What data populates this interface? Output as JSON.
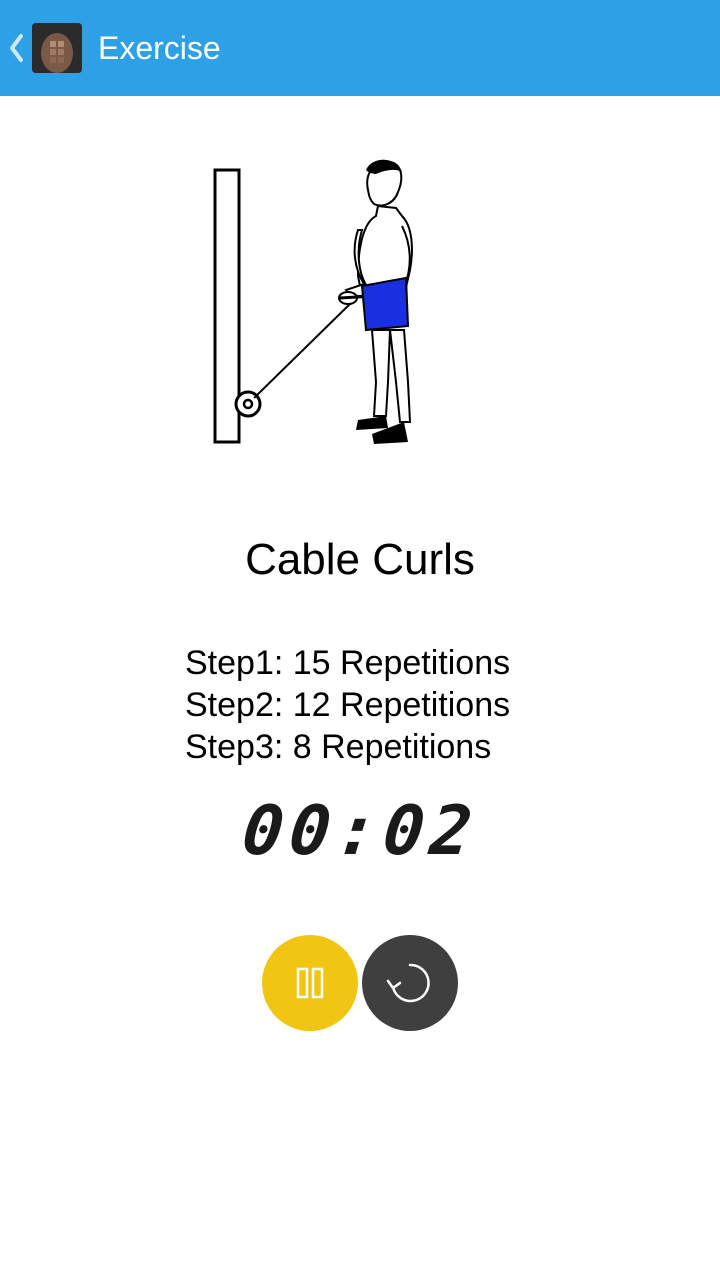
{
  "header": {
    "title": "Exercise",
    "back_icon": "chevron-left-icon",
    "app_icon": "app-logo-icon",
    "background_color": "#2ea0e6"
  },
  "exercise": {
    "name": "Cable Curls",
    "illustration": "cable-curl-illustration",
    "steps": [
      "Step1: 15 Repetitions",
      "Step2: 12 Repetitions",
      "Step3: 8 Repetitions"
    ]
  },
  "timer": {
    "display": "00:02"
  },
  "controls": {
    "pause": {
      "icon": "pause-icon",
      "color": "#f0c514"
    },
    "reset": {
      "icon": "reset-icon",
      "color": "#3f3f3f"
    }
  }
}
